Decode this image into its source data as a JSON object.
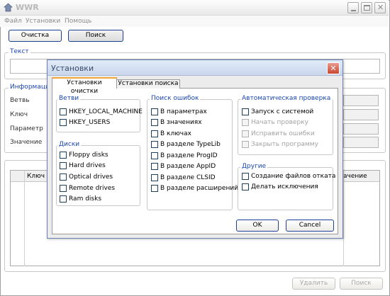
{
  "app": {
    "title": "WWR",
    "menu": [
      "Файл",
      "Установки",
      "Помощь"
    ],
    "clean_button": "Очистка",
    "search_button": "Поиск",
    "text_group": "Текст",
    "info_group": "Информация",
    "info_labels": [
      "Ветвь",
      "Ключ",
      "Параметр",
      "Значение"
    ],
    "table_headers": [
      "Ключ",
      "ачение"
    ],
    "delete_button": "Удалить",
    "search_button2": "Поиск"
  },
  "dialog": {
    "title": "Установки",
    "tabs": [
      "Установки очистки",
      "Установки поиска"
    ],
    "branches": {
      "label": "Ветви",
      "items": [
        {
          "text": "HKEY_LOCAL_MACHINE",
          "checked": false
        },
        {
          "text": "HKEY_USERS",
          "checked": false
        }
      ]
    },
    "disks": {
      "label": "Диски",
      "items": [
        {
          "text": "Floppy disks",
          "checked": false
        },
        {
          "text": "Hard drives",
          "checked": false
        },
        {
          "text": "Optical drives",
          "checked": false
        },
        {
          "text": "Remote drives",
          "checked": false
        },
        {
          "text": "Ram disks",
          "checked": false
        }
      ]
    },
    "errors": {
      "label": "Поиск ошибок",
      "items": [
        {
          "text": "В параметрах",
          "checked": false
        },
        {
          "text": "В значениях",
          "checked": false
        },
        {
          "text": "В ключах",
          "checked": false
        },
        {
          "text": "В разделе TypeLib",
          "checked": false
        },
        {
          "text": "В разделе ProgID",
          "checked": false
        },
        {
          "text": "В разделе AppID",
          "checked": false
        },
        {
          "text": "В разделе CLSID",
          "checked": false
        },
        {
          "text": "В разделе расширений",
          "checked": false
        }
      ]
    },
    "auto": {
      "label": "Автоматическая проверка",
      "items": [
        {
          "text": "Запуск с системой",
          "checked": false,
          "enabled": true
        },
        {
          "text": "Начать проверку",
          "checked": false,
          "enabled": false
        },
        {
          "text": "Исправить ошибки",
          "checked": false,
          "enabled": false
        },
        {
          "text": "Закрыть программу",
          "checked": false,
          "enabled": false
        }
      ]
    },
    "other": {
      "label": "Другие",
      "items": [
        {
          "text": "Создание файлов отката",
          "checked": false
        },
        {
          "text": "Делать исключения",
          "checked": false
        }
      ]
    },
    "ok": "OK",
    "cancel": "Cancel"
  },
  "colors": {
    "accent": "#1a46b0",
    "close_button": "#d9523f"
  }
}
